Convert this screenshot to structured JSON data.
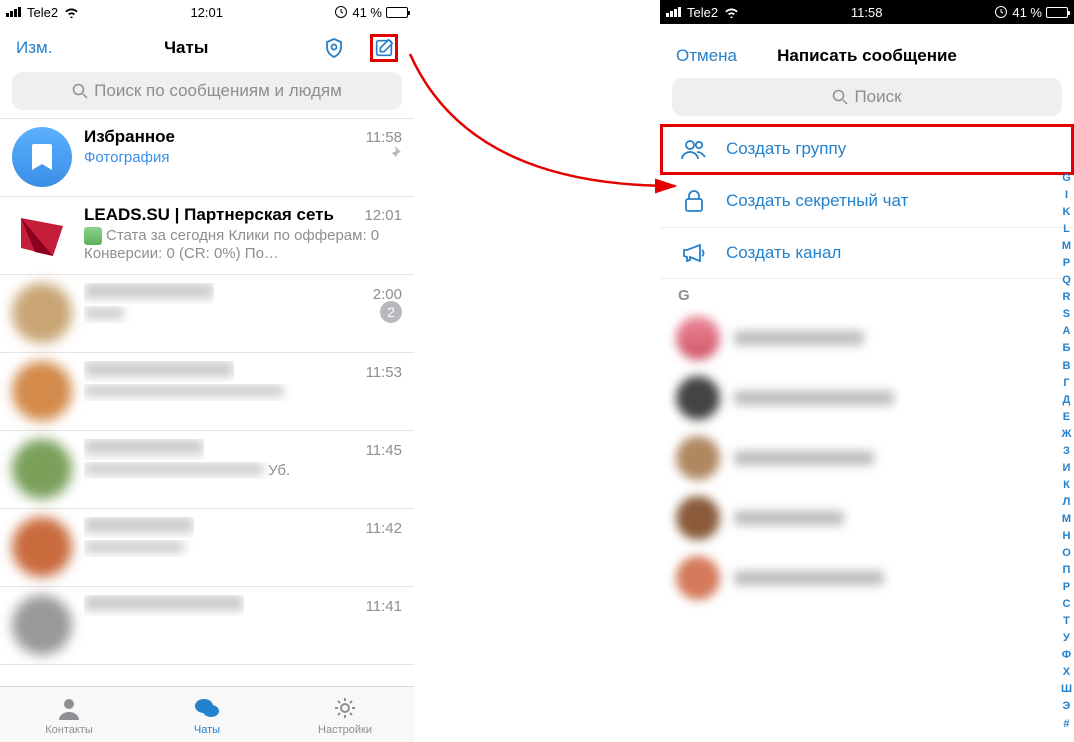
{
  "left": {
    "status": {
      "carrier": "Tele2",
      "time": "12:01",
      "battery": "41 %"
    },
    "nav": {
      "edit": "Изм.",
      "title": "Чаты"
    },
    "search_placeholder": "Поиск по сообщениям и людям",
    "chats": [
      {
        "name": "Избранное",
        "preview": "Фотография",
        "time": "11:58",
        "pinned": true,
        "avatar": "fav"
      },
      {
        "name": "LEADS.SU | Партнерская сеть",
        "preview": "Стата за сегодня Клики по офферам: 0 Конверсии: 0 (CR: 0%) По…",
        "time": "12:01",
        "avatar": "leads",
        "media_thumb": true
      },
      {
        "name": "",
        "preview": "",
        "time": "2:00",
        "badge": "2",
        "blurred": true
      },
      {
        "name": "",
        "preview": "",
        "time": "11:53",
        "blurred": true
      },
      {
        "name": "",
        "preview": "",
        "time": "11:45",
        "blurred": true,
        "trailing": "Уб."
      },
      {
        "name": "",
        "preview": "",
        "time": "11:42",
        "blurred": true
      },
      {
        "name": "",
        "preview": "",
        "time": "11:41",
        "blurred": true
      }
    ],
    "tabs": {
      "contacts": "Контакты",
      "chats": "Чаты",
      "settings": "Настройки"
    }
  },
  "right": {
    "status": {
      "carrier": "Tele2",
      "time": "11:58",
      "battery": "41 %"
    },
    "modal": {
      "cancel": "Отмена",
      "title": "Написать сообщение",
      "search_placeholder": "Поиск",
      "actions": {
        "group": "Создать группу",
        "secret": "Создать секретный чат",
        "channel": "Создать канал"
      },
      "section": "G"
    },
    "alpha": [
      "G",
      "I",
      "K",
      "L",
      "M",
      "P",
      "Q",
      "R",
      "S",
      "А",
      "Б",
      "В",
      "Г",
      "Д",
      "Е",
      "Ж",
      "З",
      "И",
      "К",
      "Л",
      "М",
      "Н",
      "О",
      "П",
      "Р",
      "С",
      "Т",
      "У",
      "Ф",
      "Х",
      "Ш",
      "Э",
      "#"
    ]
  }
}
